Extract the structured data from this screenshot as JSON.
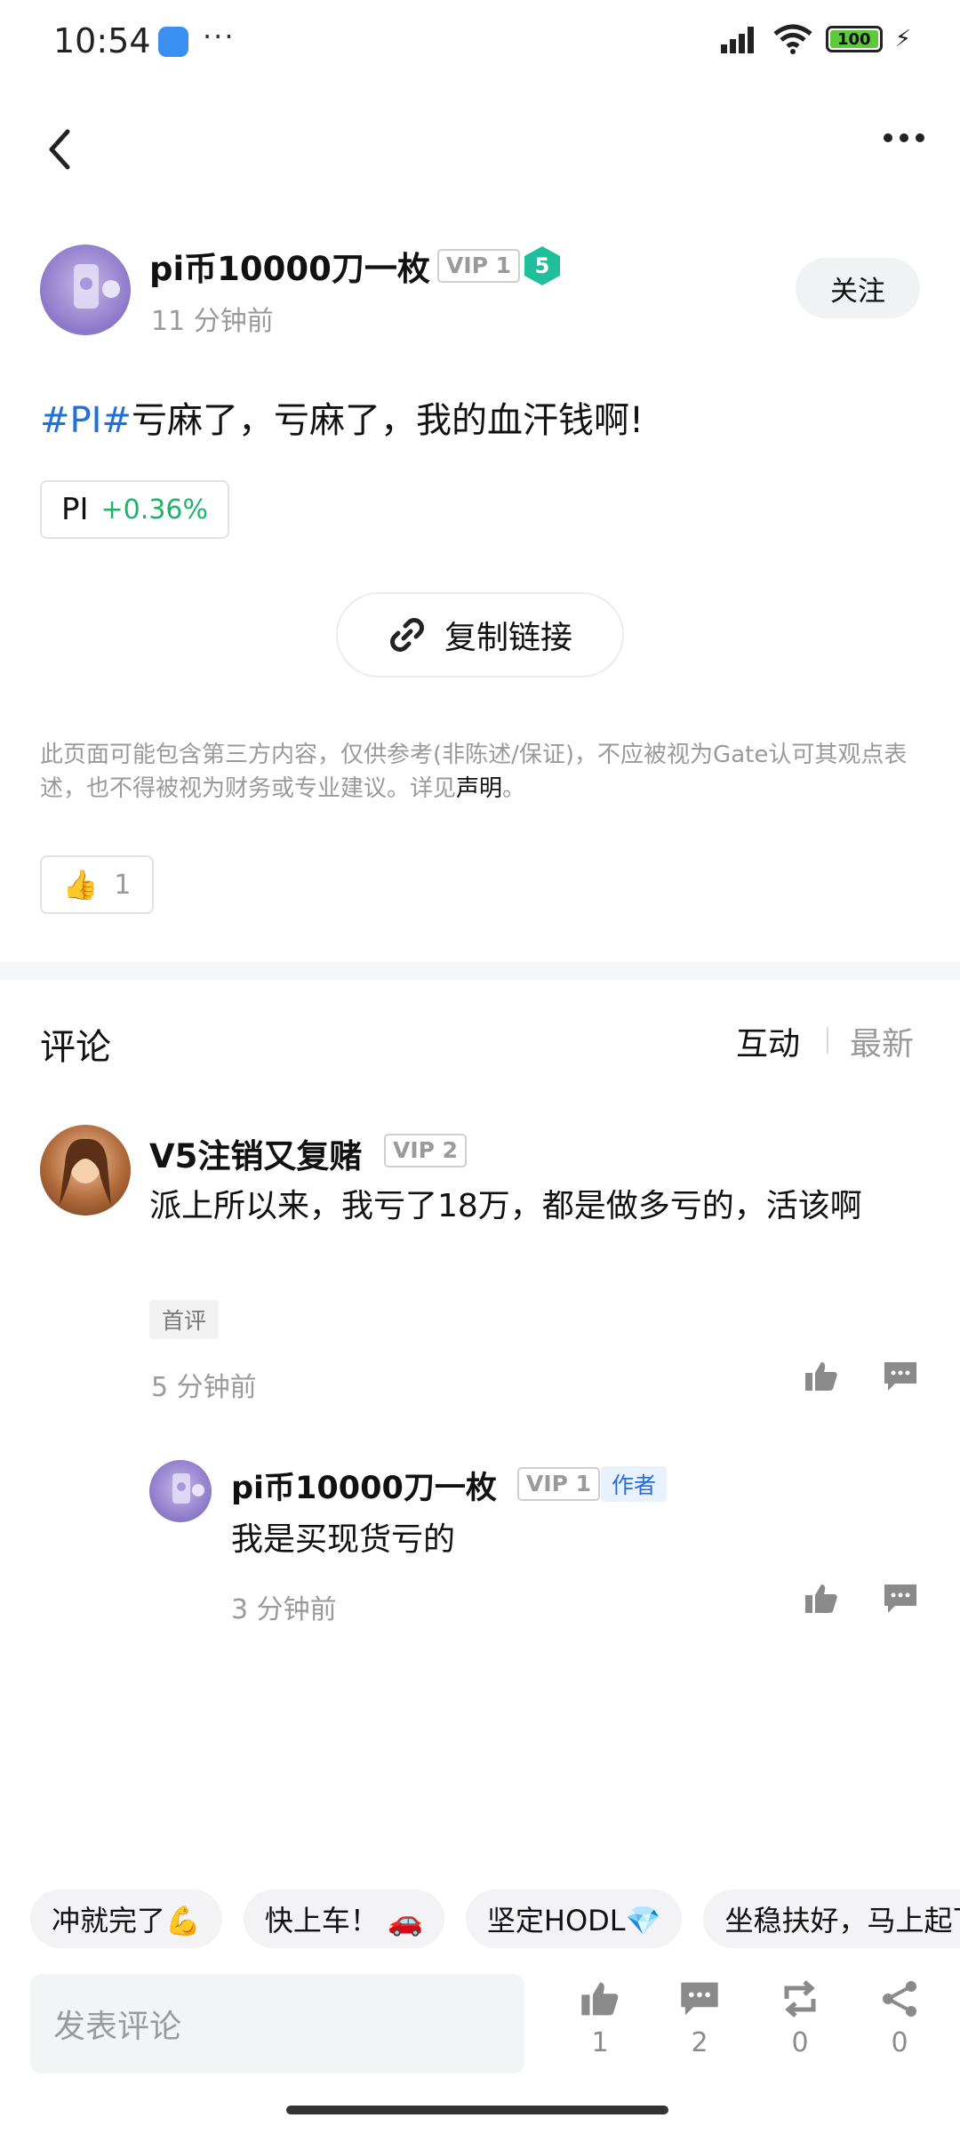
{
  "status_bar": {
    "time": "10:54",
    "battery": "100"
  },
  "post": {
    "author_name": "pi币10000刀一枚",
    "author_vip": "VIP 1",
    "level": "5",
    "time": "11 分钟前",
    "follow_label": "关注",
    "tag": "#PI#",
    "text": "亏麻了，亏麻了，我的血汗钱啊!",
    "coin_symbol": "PI",
    "coin_change": "+0.36%",
    "copy_link_label": "复制链接",
    "disclaimer": "此页面可能包含第三方内容，仅供参考(非陈述/保证)，不应被视为Gate认可其观点表述，也不得被视为财务或专业建议。详见",
    "disclaimer_link": "声明",
    "disclaimer_end": "。",
    "like_count": "1"
  },
  "comments_section": {
    "title": "评论",
    "sort_interactive": "互动",
    "sort_latest": "最新",
    "comments": [
      {
        "name": "V5注销又复赌",
        "vip": "VIP 2",
        "text": "派上所以来，我亏了18万，都是做多亏的，活该啊",
        "tag": "首评",
        "time": "5 分钟前",
        "replies": [
          {
            "name": "pi币10000刀一枚",
            "vip": "VIP 1",
            "author_tag": "作者",
            "text": "我是买现货亏的",
            "time": "3 分钟前"
          }
        ]
      }
    ]
  },
  "quick_replies": [
    "冲就完了💪",
    "快上车！ 🚗",
    "坚定HODL💎",
    "坐稳扶好，马上起飞"
  ],
  "bottom_bar": {
    "input_placeholder": "发表评论",
    "like_count": "1",
    "comment_count": "2",
    "repost_count": "0",
    "share_count": "0"
  }
}
